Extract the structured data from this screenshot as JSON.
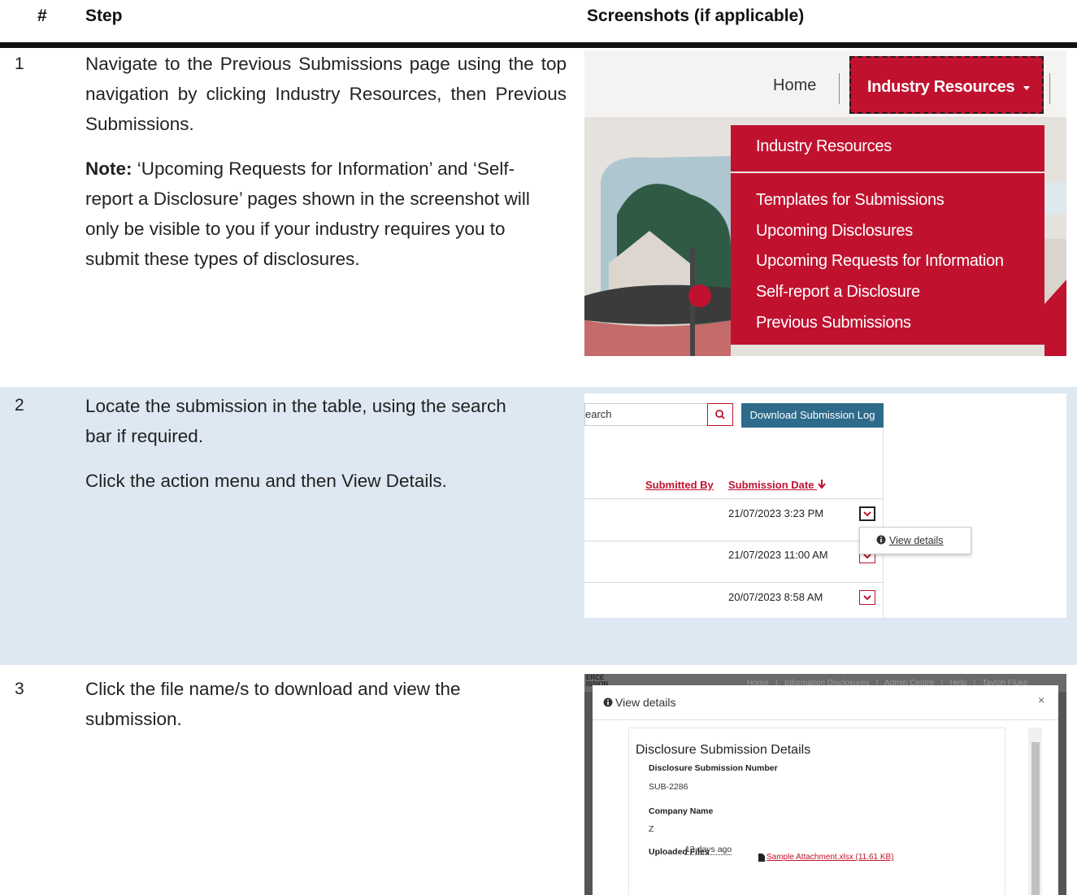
{
  "table": {
    "headers": {
      "num": "#",
      "step": "Step",
      "screenshots": "Screenshots (if applicable)"
    },
    "rows": [
      {
        "num": "1",
        "text": "Navigate to the Previous Submissions page using the top navigation by clicking Industry Resources, then Previous Submissions.",
        "note_label": "Note:",
        "note_text": " ‘Upcoming Requests for Information’ and ‘Self-report a Disclosure’ pages shown in the screenshot will only be visible to you if your industry requires you to submit these types of disclosures."
      },
      {
        "num": "2",
        "text1": "Locate the submission in the table, using the search bar if required.",
        "text2": "Click the action menu and then View Details."
      },
      {
        "num": "3",
        "text": "Click the file name/s to download and view the submission."
      }
    ]
  },
  "shot1": {
    "home": "Home",
    "industry_resources_btn": "Industry Resources",
    "menu": [
      "Industry Resources",
      "Templates for Submissions",
      "Upcoming Disclosures",
      "Upcoming Requests for Information",
      "Self-report a Disclosure",
      "Previous Submissions"
    ]
  },
  "shot2": {
    "search_partial": "earch",
    "download_btn": "Download Submission Log",
    "col_submitted_by": "Submitted By",
    "col_submission_date": "Submission Date",
    "dates": [
      "21/07/2023 3:23 PM",
      "21/07/2023 11:00 AM",
      "20/07/2023 8:58 AM"
    ],
    "popup": "View details"
  },
  "shot3": {
    "bg_fragment_left": "ERCE\nISSION",
    "bg_fragment_right": "Home   |   Information Disclosures   |   Admin Centre   |   Help   |   Tayloh Fluke",
    "modal_title": "View details",
    "close": "×",
    "heading": "Disclosure Submission Details",
    "label_number": "Disclosure Submission Number",
    "value_number": "SUB-2286",
    "label_company": "Company Name",
    "value_company": "Z",
    "label_files": "Uploaded Files",
    "uploaded_ago": "13 days ago",
    "file_link": "Sample Attachment.xlsx (11.61 KB)"
  },
  "colors": {
    "brand_red": "#c0122f",
    "button_blue": "#2e6b8b",
    "row_blue": "#dde8f2"
  }
}
